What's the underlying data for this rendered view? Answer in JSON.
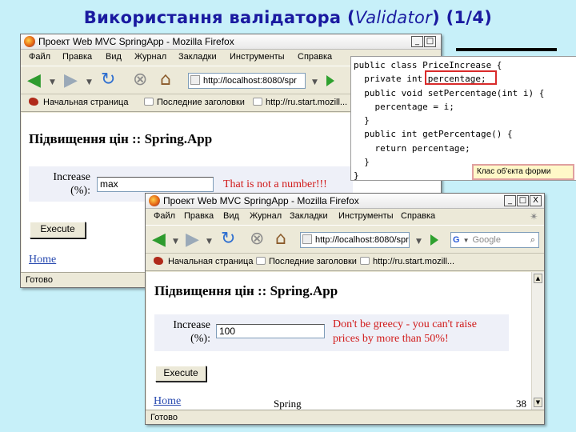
{
  "slide": {
    "title_main": "Використання валідатора (",
    "title_italic": "Validator",
    "title_end": ") (1/4)",
    "footer_text": "Spring",
    "page_number": "38"
  },
  "browser": {
    "window_title": "Проект Web MVC SpringApp - Mozilla Firefox",
    "menu": [
      "Файл",
      "Правка",
      "Вид",
      "Журнал",
      "Закладки",
      "Инструменты",
      "Справка"
    ],
    "url": "http://localhost:8080/spr",
    "search_placeholder": "Google",
    "bookmarks": [
      "Начальная страница",
      "Последние заголовки",
      "http://ru.start.mozill..."
    ],
    "status": "Готово",
    "win_controls": [
      "_",
      "□",
      "X"
    ]
  },
  "page": {
    "title": "Підвищення цін :: Spring.App",
    "increase_label_line1": "Increase",
    "increase_label_line2": "(%):",
    "execute_label": "Execute",
    "home_link": "Home"
  },
  "window1": {
    "input_value": "max",
    "error": "That is not a number!!!"
  },
  "window2": {
    "input_value": "100",
    "error_line1": "Don't be greecy - you can't raise",
    "error_line2": "prices by more than 50%!"
  },
  "code": {
    "lines": [
      "public class PriceIncrease {",
      "  private int percentage;",
      "  public void setPercentage(int i) {",
      "    percentage = i;",
      "  }",
      "  public int getPercentage() {",
      "    return percentage;",
      "  }",
      "}"
    ],
    "highlight": "percentage;",
    "callout": "Клас об'єкта форми"
  },
  "colors": {
    "slide_bg": "#c7f0f9",
    "title_color": "#1a1aa0",
    "error_color": "#d11a1a",
    "link_color": "#2a4bb0",
    "highlight_color": "#d92a2a"
  }
}
